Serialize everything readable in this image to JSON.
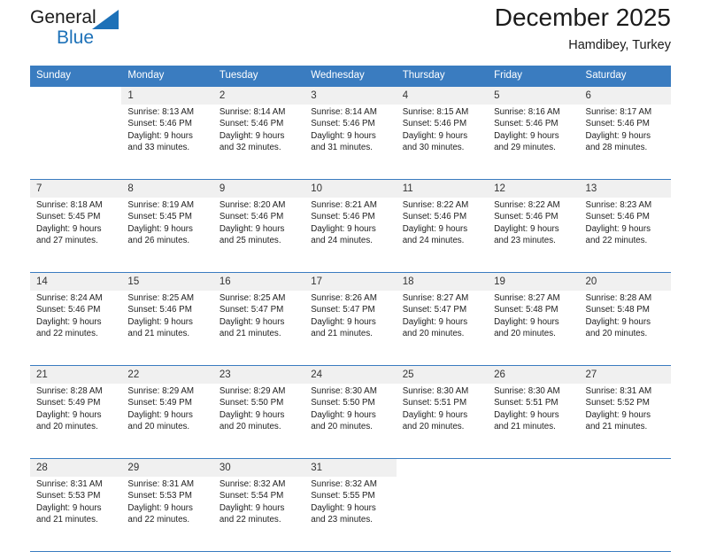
{
  "brand": {
    "name_part1": "General",
    "name_part2": "Blue",
    "accent_color": "#1d71b8"
  },
  "header": {
    "title": "December 2025",
    "subtitle": "Hamdibey, Turkey"
  },
  "calendar": {
    "header_color": "#3a7cc0",
    "daynum_bg": "#f0f0f0",
    "weekdays": [
      "Sunday",
      "Monday",
      "Tuesday",
      "Wednesday",
      "Thursday",
      "Friday",
      "Saturday"
    ],
    "weeks": [
      [
        {
          "day": "",
          "lines": []
        },
        {
          "day": "1",
          "lines": [
            "Sunrise: 8:13 AM",
            "Sunset: 5:46 PM",
            "Daylight: 9 hours",
            "and 33 minutes."
          ]
        },
        {
          "day": "2",
          "lines": [
            "Sunrise: 8:14 AM",
            "Sunset: 5:46 PM",
            "Daylight: 9 hours",
            "and 32 minutes."
          ]
        },
        {
          "day": "3",
          "lines": [
            "Sunrise: 8:14 AM",
            "Sunset: 5:46 PM",
            "Daylight: 9 hours",
            "and 31 minutes."
          ]
        },
        {
          "day": "4",
          "lines": [
            "Sunrise: 8:15 AM",
            "Sunset: 5:46 PM",
            "Daylight: 9 hours",
            "and 30 minutes."
          ]
        },
        {
          "day": "5",
          "lines": [
            "Sunrise: 8:16 AM",
            "Sunset: 5:46 PM",
            "Daylight: 9 hours",
            "and 29 minutes."
          ]
        },
        {
          "day": "6",
          "lines": [
            "Sunrise: 8:17 AM",
            "Sunset: 5:46 PM",
            "Daylight: 9 hours",
            "and 28 minutes."
          ]
        }
      ],
      [
        {
          "day": "7",
          "lines": [
            "Sunrise: 8:18 AM",
            "Sunset: 5:45 PM",
            "Daylight: 9 hours",
            "and 27 minutes."
          ]
        },
        {
          "day": "8",
          "lines": [
            "Sunrise: 8:19 AM",
            "Sunset: 5:45 PM",
            "Daylight: 9 hours",
            "and 26 minutes."
          ]
        },
        {
          "day": "9",
          "lines": [
            "Sunrise: 8:20 AM",
            "Sunset: 5:46 PM",
            "Daylight: 9 hours",
            "and 25 minutes."
          ]
        },
        {
          "day": "10",
          "lines": [
            "Sunrise: 8:21 AM",
            "Sunset: 5:46 PM",
            "Daylight: 9 hours",
            "and 24 minutes."
          ]
        },
        {
          "day": "11",
          "lines": [
            "Sunrise: 8:22 AM",
            "Sunset: 5:46 PM",
            "Daylight: 9 hours",
            "and 24 minutes."
          ]
        },
        {
          "day": "12",
          "lines": [
            "Sunrise: 8:22 AM",
            "Sunset: 5:46 PM",
            "Daylight: 9 hours",
            "and 23 minutes."
          ]
        },
        {
          "day": "13",
          "lines": [
            "Sunrise: 8:23 AM",
            "Sunset: 5:46 PM",
            "Daylight: 9 hours",
            "and 22 minutes."
          ]
        }
      ],
      [
        {
          "day": "14",
          "lines": [
            "Sunrise: 8:24 AM",
            "Sunset: 5:46 PM",
            "Daylight: 9 hours",
            "and 22 minutes."
          ]
        },
        {
          "day": "15",
          "lines": [
            "Sunrise: 8:25 AM",
            "Sunset: 5:46 PM",
            "Daylight: 9 hours",
            "and 21 minutes."
          ]
        },
        {
          "day": "16",
          "lines": [
            "Sunrise: 8:25 AM",
            "Sunset: 5:47 PM",
            "Daylight: 9 hours",
            "and 21 minutes."
          ]
        },
        {
          "day": "17",
          "lines": [
            "Sunrise: 8:26 AM",
            "Sunset: 5:47 PM",
            "Daylight: 9 hours",
            "and 21 minutes."
          ]
        },
        {
          "day": "18",
          "lines": [
            "Sunrise: 8:27 AM",
            "Sunset: 5:47 PM",
            "Daylight: 9 hours",
            "and 20 minutes."
          ]
        },
        {
          "day": "19",
          "lines": [
            "Sunrise: 8:27 AM",
            "Sunset: 5:48 PM",
            "Daylight: 9 hours",
            "and 20 minutes."
          ]
        },
        {
          "day": "20",
          "lines": [
            "Sunrise: 8:28 AM",
            "Sunset: 5:48 PM",
            "Daylight: 9 hours",
            "and 20 minutes."
          ]
        }
      ],
      [
        {
          "day": "21",
          "lines": [
            "Sunrise: 8:28 AM",
            "Sunset: 5:49 PM",
            "Daylight: 9 hours",
            "and 20 minutes."
          ]
        },
        {
          "day": "22",
          "lines": [
            "Sunrise: 8:29 AM",
            "Sunset: 5:49 PM",
            "Daylight: 9 hours",
            "and 20 minutes."
          ]
        },
        {
          "day": "23",
          "lines": [
            "Sunrise: 8:29 AM",
            "Sunset: 5:50 PM",
            "Daylight: 9 hours",
            "and 20 minutes."
          ]
        },
        {
          "day": "24",
          "lines": [
            "Sunrise: 8:30 AM",
            "Sunset: 5:50 PM",
            "Daylight: 9 hours",
            "and 20 minutes."
          ]
        },
        {
          "day": "25",
          "lines": [
            "Sunrise: 8:30 AM",
            "Sunset: 5:51 PM",
            "Daylight: 9 hours",
            "and 20 minutes."
          ]
        },
        {
          "day": "26",
          "lines": [
            "Sunrise: 8:30 AM",
            "Sunset: 5:51 PM",
            "Daylight: 9 hours",
            "and 21 minutes."
          ]
        },
        {
          "day": "27",
          "lines": [
            "Sunrise: 8:31 AM",
            "Sunset: 5:52 PM",
            "Daylight: 9 hours",
            "and 21 minutes."
          ]
        }
      ],
      [
        {
          "day": "28",
          "lines": [
            "Sunrise: 8:31 AM",
            "Sunset: 5:53 PM",
            "Daylight: 9 hours",
            "and 21 minutes."
          ]
        },
        {
          "day": "29",
          "lines": [
            "Sunrise: 8:31 AM",
            "Sunset: 5:53 PM",
            "Daylight: 9 hours",
            "and 22 minutes."
          ]
        },
        {
          "day": "30",
          "lines": [
            "Sunrise: 8:32 AM",
            "Sunset: 5:54 PM",
            "Daylight: 9 hours",
            "and 22 minutes."
          ]
        },
        {
          "day": "31",
          "lines": [
            "Sunrise: 8:32 AM",
            "Sunset: 5:55 PM",
            "Daylight: 9 hours",
            "and 23 minutes."
          ]
        },
        {
          "day": "",
          "lines": []
        },
        {
          "day": "",
          "lines": []
        },
        {
          "day": "",
          "lines": []
        }
      ]
    ]
  }
}
